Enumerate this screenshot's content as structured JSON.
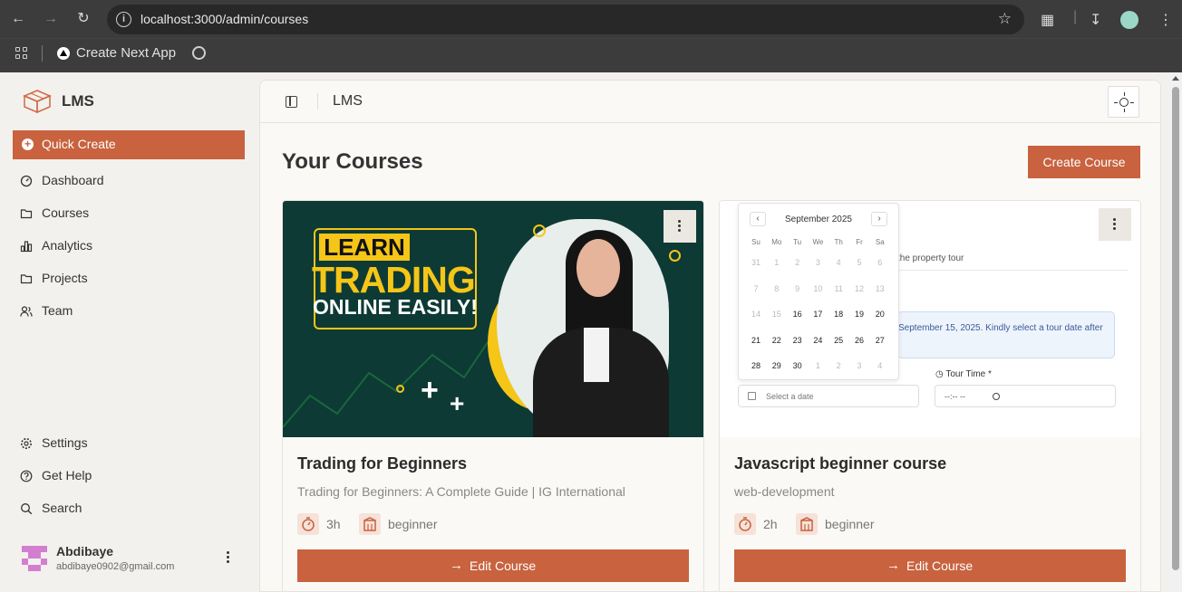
{
  "browser": {
    "url": "localhost:3000/admin/courses",
    "bookmark_label": "Create Next App"
  },
  "sidebar": {
    "brand": "LMS",
    "quick_create": "Quick Create",
    "items": [
      {
        "label": "Dashboard",
        "icon": "gauge-icon"
      },
      {
        "label": "Courses",
        "icon": "folder-icon"
      },
      {
        "label": "Analytics",
        "icon": "bar-chart-icon"
      },
      {
        "label": "Projects",
        "icon": "folder-icon"
      },
      {
        "label": "Team",
        "icon": "users-icon"
      }
    ],
    "bottom_items": [
      {
        "label": "Settings",
        "icon": "gear-icon"
      },
      {
        "label": "Get Help",
        "icon": "help-icon"
      },
      {
        "label": "Search",
        "icon": "search-icon"
      }
    ],
    "user": {
      "name": "Abdibaye",
      "email": "abdibaye0902@gmail.com"
    }
  },
  "header": {
    "title": "LMS"
  },
  "page": {
    "title": "Your Courses",
    "create_button": "Create Course"
  },
  "courses": [
    {
      "title": "Trading for Beginners",
      "description": "Trading for Beginners: A Complete Guide | IG International",
      "duration": "3h",
      "level": "beginner",
      "edit_label": "Edit Course",
      "thumbnail": {
        "learn": "LEARN",
        "trading": "TRADING",
        "online": "ONLINE EASILY!"
      }
    },
    {
      "title": "Javascript beginner course",
      "description": "web-development",
      "duration": "2h",
      "level": "beginner",
      "edit_label": "Edit Course",
      "thumbnail": {
        "month": "September 2025",
        "weekdays": [
          "Su",
          "Mo",
          "Tu",
          "We",
          "Th",
          "Fr",
          "Sa"
        ],
        "weeks": [
          [
            "31",
            "1",
            "2",
            "3",
            "4",
            "5",
            "6"
          ],
          [
            "7",
            "8",
            "9",
            "10",
            "11",
            "12",
            "13"
          ],
          [
            "14",
            "15",
            "16",
            "17",
            "18",
            "19",
            "20"
          ],
          [
            "21",
            "22",
            "23",
            "24",
            "25",
            "26",
            "27"
          ],
          [
            "28",
            "29",
            "30",
            "1",
            "2",
            "3",
            "4"
          ]
        ],
        "tour_text": "the property tour",
        "info_text": "September 15, 2025. Kindly select a tour date after",
        "tour_time_label": "Tour Time *",
        "date_placeholder": "Select a date",
        "time_placeholder": "--:-- --"
      }
    }
  ],
  "colors": {
    "accent": "#c8623f",
    "background": "#f3f1ed"
  }
}
